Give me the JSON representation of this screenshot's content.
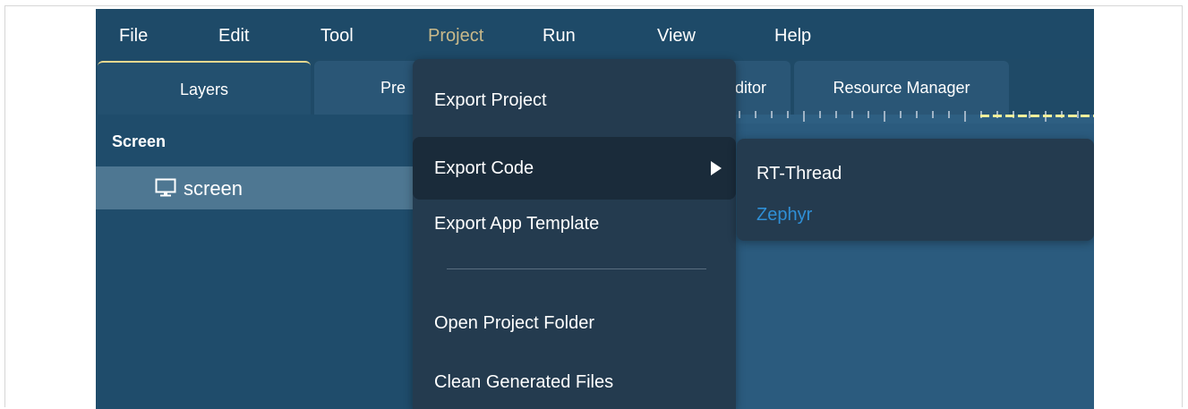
{
  "menubar": {
    "items": [
      {
        "label": "File"
      },
      {
        "label": "Edit"
      },
      {
        "label": "Tool"
      },
      {
        "label": "Project"
      },
      {
        "label": "Run"
      },
      {
        "label": "View"
      },
      {
        "label": "Help"
      }
    ],
    "active": "Project"
  },
  "tabs": [
    {
      "label": "Layers"
    },
    {
      "label": "Pre"
    },
    {
      "label": "ditor"
    },
    {
      "label": "Resource Manager"
    }
  ],
  "layers_panel": {
    "title": "Screen",
    "tree": [
      {
        "label": "screen",
        "icon": "monitor-icon"
      }
    ]
  },
  "project_menu": {
    "items": [
      {
        "label": "Export Project"
      },
      {
        "label": "Export Code",
        "has_submenu": true
      },
      {
        "label": "Export App Template"
      },
      {
        "label": "Open Project Folder"
      },
      {
        "label": "Clean Generated Files"
      }
    ]
  },
  "export_code_submenu": {
    "items": [
      {
        "label": "RT-Thread",
        "color": "#ffffff"
      },
      {
        "label": "Zephyr",
        "color": "#2f8fd6"
      }
    ]
  },
  "colors": {
    "menubar_bg": "#1e4a68",
    "active_menu": "#c9b98a",
    "dropdown_bg": "#243b4f",
    "canvas_bg": "#2b5b7e",
    "ruler_highlight": "#f2ef9a"
  }
}
